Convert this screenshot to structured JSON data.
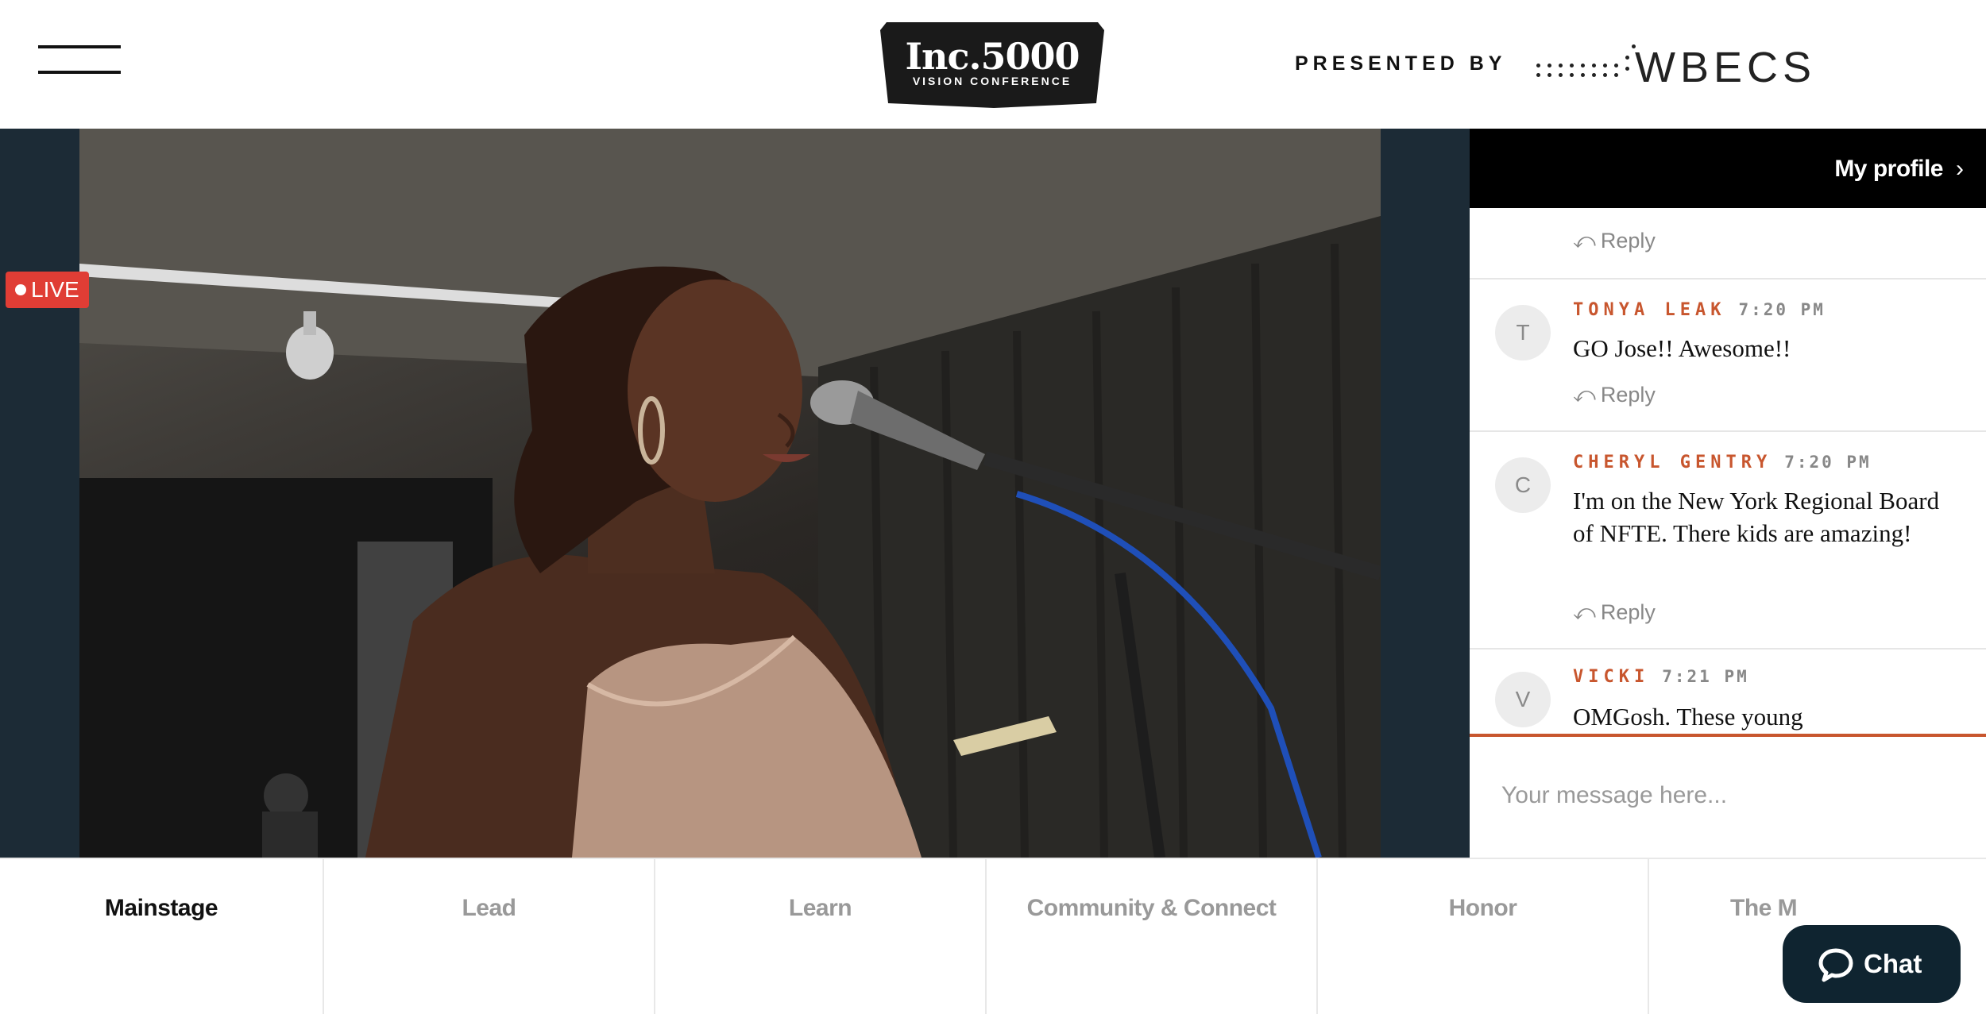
{
  "header": {
    "brand_main": "Inc.5000",
    "brand_sub": "VISION CONFERENCE",
    "presented_by": "PRESENTED BY",
    "sponsor": "WBECS"
  },
  "stage": {
    "live_label": "LIVE"
  },
  "sidebar": {
    "profile_label": "My profile",
    "reply_label": "Reply",
    "messages": [
      {
        "initial": "T",
        "name": "TONYA LEAK",
        "time": "7:20 PM",
        "text": "GO Jose!! Awesome!!"
      },
      {
        "initial": "C",
        "name": "CHERYL GENTRY",
        "time": "7:20 PM",
        "text": "I'm on the New York Regional Board of NFTE. There kids are amazing!"
      },
      {
        "initial": "V",
        "name": "VICKI",
        "time": "7:21 PM",
        "text": "OMGosh. These young"
      }
    ],
    "input_placeholder": "Your message here..."
  },
  "tabs": [
    "Mainstage",
    "Lead",
    "Learn",
    "Community & Connect",
    "Honor",
    "The M"
  ],
  "active_tab": "Mainstage",
  "chat_button": "Chat",
  "colors": {
    "accent": "#c8562e",
    "live": "#e03d35",
    "stage_bg": "#1c2b36",
    "chat_button_bg": "#0f2430"
  }
}
